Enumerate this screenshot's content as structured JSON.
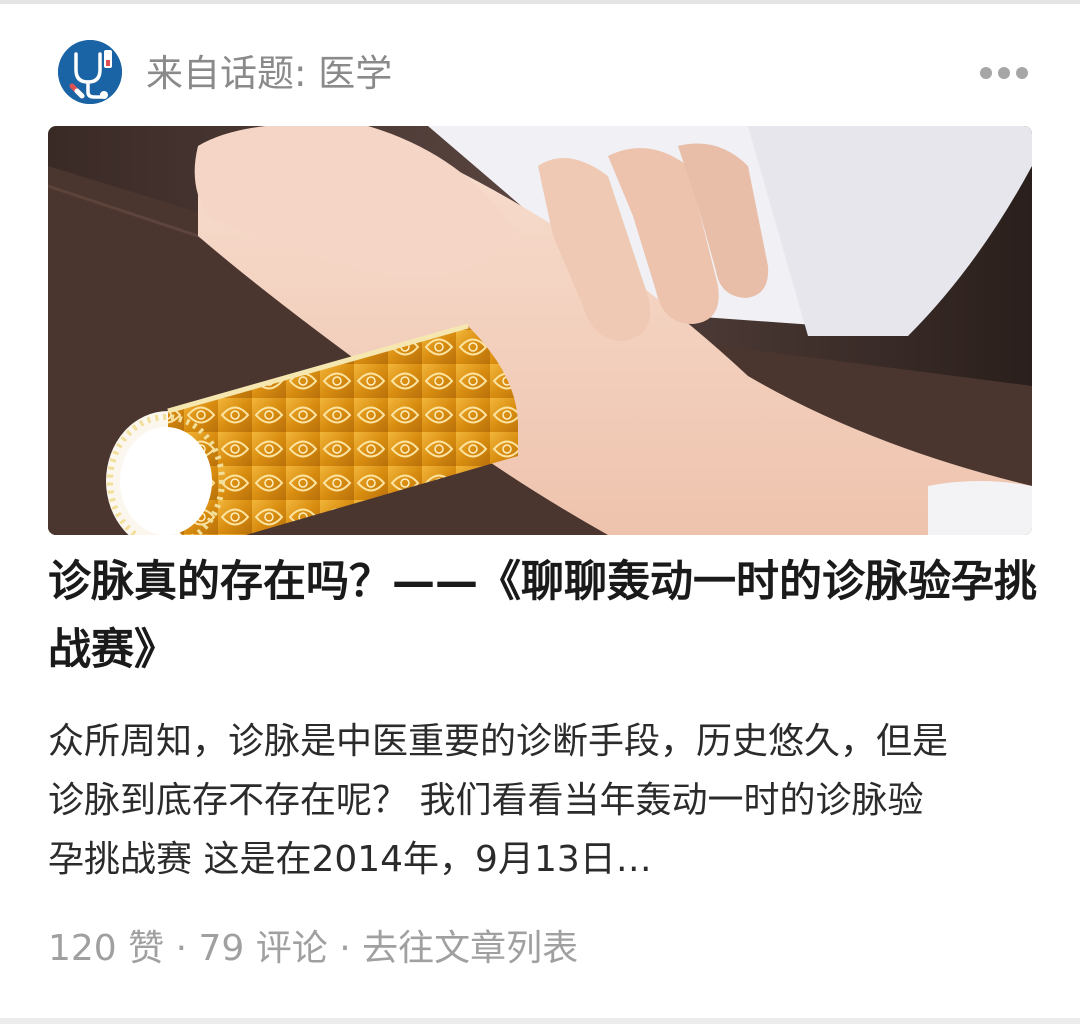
{
  "header": {
    "avatar_icon": "stethoscope-icon",
    "topic_label": "来自话题: 医学",
    "more_icon": "more-dots-icon"
  },
  "cover_image": {
    "description": "中医诊脉：医生手指按在手腕上，手腕下垫着金色脉枕"
  },
  "article": {
    "title": "诊脉真的存在吗？——《聊聊轰动一时的诊脉验孕挑战赛》",
    "excerpt": "众所周知，诊脉是中医重要的诊断手段，历史悠久，但是诊脉到底存不存在呢？ 我们看看当年轰动一时的诊脉验孕挑战赛 这是在2014年，9月13日…"
  },
  "meta": {
    "likes": "120 赞",
    "sep1": " · ",
    "comments": "79 评论",
    "sep2": " · ",
    "go_to_list": "去往文章列表"
  },
  "colors": {
    "avatar_bg": "#1a63a5",
    "meta_text": "#a0a0a0",
    "title_text": "#1a1a1a"
  }
}
